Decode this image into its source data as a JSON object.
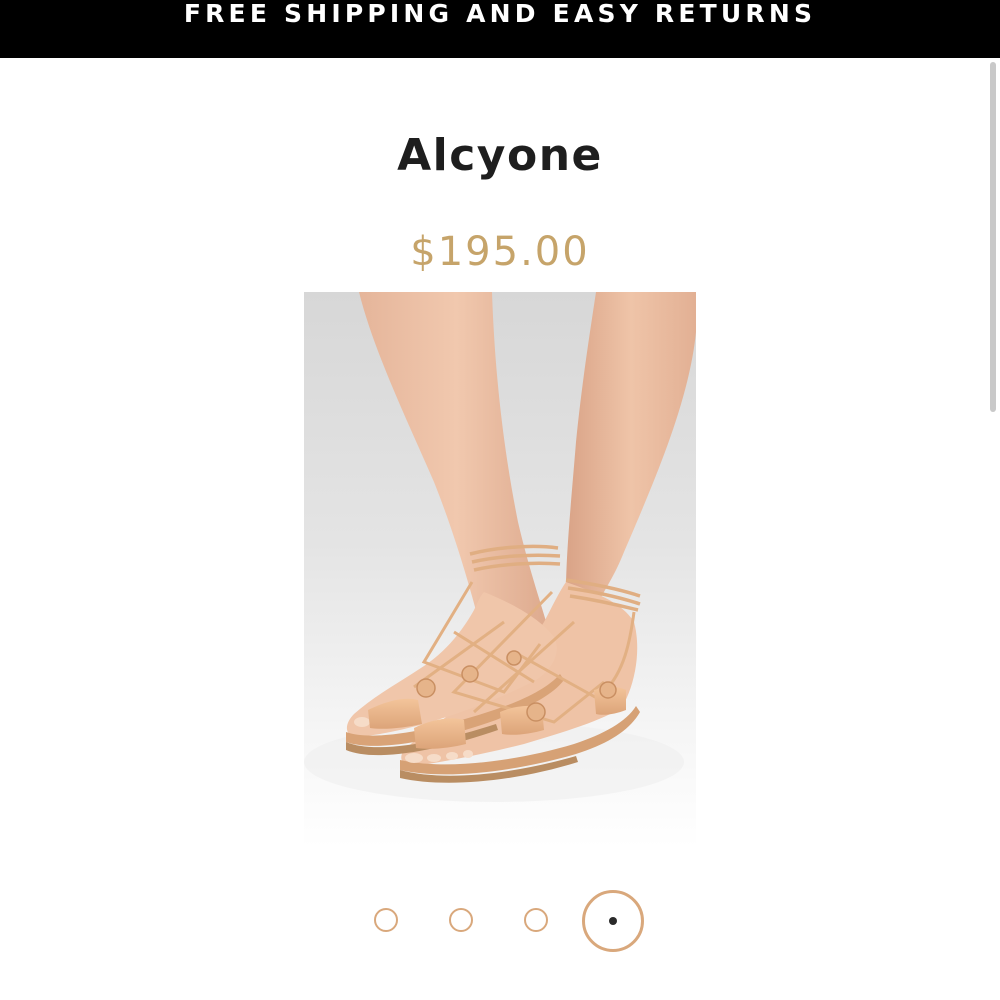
{
  "promo": {
    "text": "FREE SHIPPING AND EASY RETURNS"
  },
  "product": {
    "title": "Alcyone",
    "price": "$195.00",
    "image_alt": "Tan leather lace-up flat sandals worn on feet"
  },
  "carousel": {
    "slide_count": 4,
    "active_index": 3
  },
  "colors": {
    "promo_background": "#000000",
    "promo_text": "#ffffff",
    "title": "#1e1e1e",
    "price": "#c6a46a",
    "dot_border": "#d9a87c",
    "dot_active_center": "#2a2a2a"
  }
}
